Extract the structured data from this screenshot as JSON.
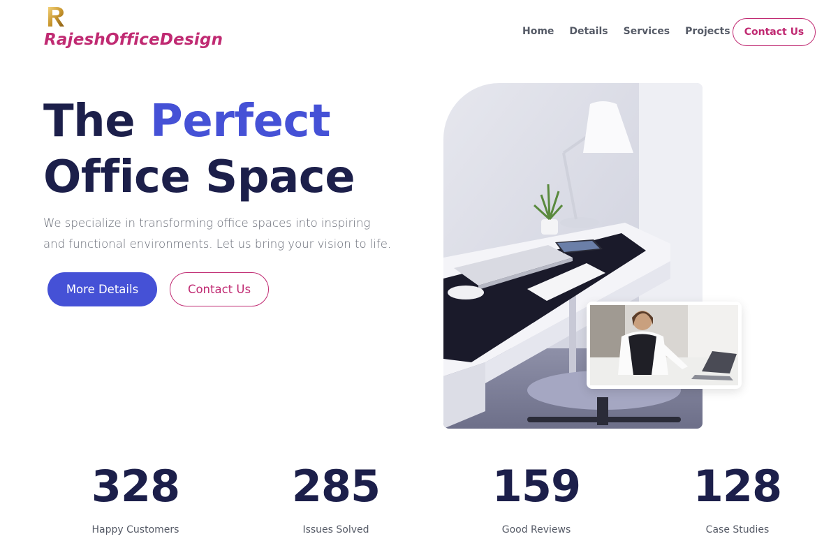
{
  "brand": {
    "logo_icon": "letter-r-monogram",
    "name": "RajeshOfficeDesign"
  },
  "nav": {
    "items": [
      "Home",
      "Details",
      "Services",
      "Projects"
    ],
    "cta": "Contact Us"
  },
  "hero": {
    "title_part1": "The ",
    "title_accent": "Perfect",
    "title_part2": "Office Space",
    "subtitle": "We specialize in transforming office spaces into inspiring and functional environments. Let us bring your vision to life.",
    "primary_button": "More Details",
    "secondary_button": "Contact Us",
    "image": "office-desk-photo",
    "inset_image": "woman-working-photo"
  },
  "stats": [
    {
      "value": "328",
      "label": "Happy Customers"
    },
    {
      "value": "285",
      "label": "Issues Solved"
    },
    {
      "value": "159",
      "label": "Good Reviews"
    },
    {
      "value": "128",
      "label": "Case Studies"
    }
  ],
  "colors": {
    "brand": "#c02a72",
    "accent": "#4551d6",
    "heading": "#1c1f4a"
  }
}
